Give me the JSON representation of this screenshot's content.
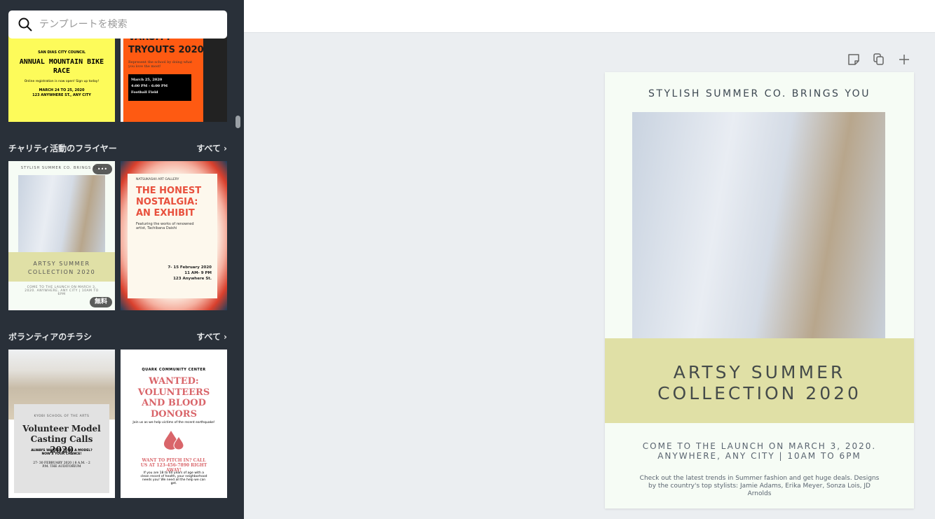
{
  "search": {
    "placeholder": "テンプレートを検索"
  },
  "sections": [
    {
      "title": "チャリティ活動のフライヤー",
      "all": "すべて"
    },
    {
      "title": "ボランティアのチラシ",
      "all": "すべて"
    }
  ],
  "thumbs": {
    "bike": {
      "org": "SAN DIAS CITY COUNCIL",
      "title": "ANNUAL MOUNTAIN BIKE RACE",
      "sub": "Online registration is now open! Sign up today!",
      "date": "MARCH 24 TO 25, 2020",
      "place": "123 ANYWHERE ST., ANY CITY"
    },
    "tryouts": {
      "title1": "VARSITY",
      "title2": "TRYOUTS 2020",
      "sub": "Represent the school by doing what you love the most!",
      "d1": "March 25, 2020",
      "d2": "4:00 PM - 6:00 PM",
      "d3": "Football Field"
    },
    "summer": {
      "top": "STYLISH SUMMER CO. BRINGS YOU",
      "title1": "ARTSY SUMMER",
      "title2": "COLLECTION 2020",
      "line": "COME TO THE LAUNCH ON MARCH 3, 2020. ANYWHERE, ANY CITY | 10AM TO 6PM",
      "badge": "無料",
      "more": "•••"
    },
    "honest": {
      "org": "NATSUKASHII ART GALLERY",
      "title": "THE HONEST NOSTALGIA: AN EXHIBIT",
      "sub": "Featuring the works of renowned artist, Tachibana Daishi",
      "d1": "7- 15 February 2020",
      "d2": "11 AM- 9 PM",
      "d3": "123 Anywhere St."
    },
    "casting": {
      "org": "KYOBI SCHOOL OF THE ARTS",
      "title": "Volunteer Model Casting Calls 2020",
      "sub": "ALWAYS WANTED TO BE A MODEL? NOW'S YOUR CHANCE!",
      "date": "27- 30 FEBRUARY 2020 | 8 A.M. - 2 P.M. THE AUDITORIUM"
    },
    "blood": {
      "org": "QUARK COMMUNITY CENTER",
      "title": "WANTED: VOLUNTEERS AND BLOOD DONORS",
      "sub": "Join us as we help victims of the recent earthquake!",
      "call": "WANT TO PITCH IN? CALL US AT 123-456-7890 RIGHT AWAY!",
      "body": "If you are 18 to 60 years of age with a clean record of health, your neighborhood needs you! We need all the help we can get."
    }
  },
  "canvas": {
    "top": "STYLISH SUMMER CO. BRINGS YOU",
    "title1": "ARTSY SUMMER",
    "title2": "COLLECTION 2020",
    "line1": "COME TO THE LAUNCH ON MARCH 3, 2020.",
    "line2": "ANYWHERE, ANY CITY | 10AM TO 6PM",
    "body": "Check out the latest trends in Summer fashion and get huge deals. Designs by the country's top stylists: Jamie Adams, Erika Meyer, Sonza Lois, JD Arnolds",
    "band_color": "#e0e0a6"
  },
  "icons": {
    "note": "sticky-note-icon",
    "copy": "duplicate-icon",
    "add": "plus-icon",
    "collapse": "chevron-left-icon"
  }
}
